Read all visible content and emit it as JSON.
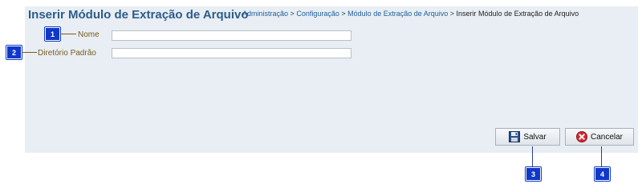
{
  "page": {
    "title": "Inserir Módulo de Extração de Arquivo",
    "breadcrumb": {
      "items": [
        "Administração",
        "Configuração",
        "Módulo de Extração de Arquivo"
      ],
      "separator": ">",
      "current": "Inserir Módulo de Extração de Arquivo"
    }
  },
  "form": {
    "fields": [
      {
        "label": "Nome",
        "value": ""
      },
      {
        "label": "Diretório Padrão",
        "value": ""
      }
    ]
  },
  "actions": {
    "save_label": "Salvar",
    "cancel_label": "Cancelar"
  },
  "callouts": [
    "1",
    "2",
    "3",
    "4"
  ],
  "colors": {
    "panel_bg": "#e8eef3",
    "title": "#2e5c8a",
    "label": "#7a5a1e",
    "callout_bg": "#1038c8"
  }
}
